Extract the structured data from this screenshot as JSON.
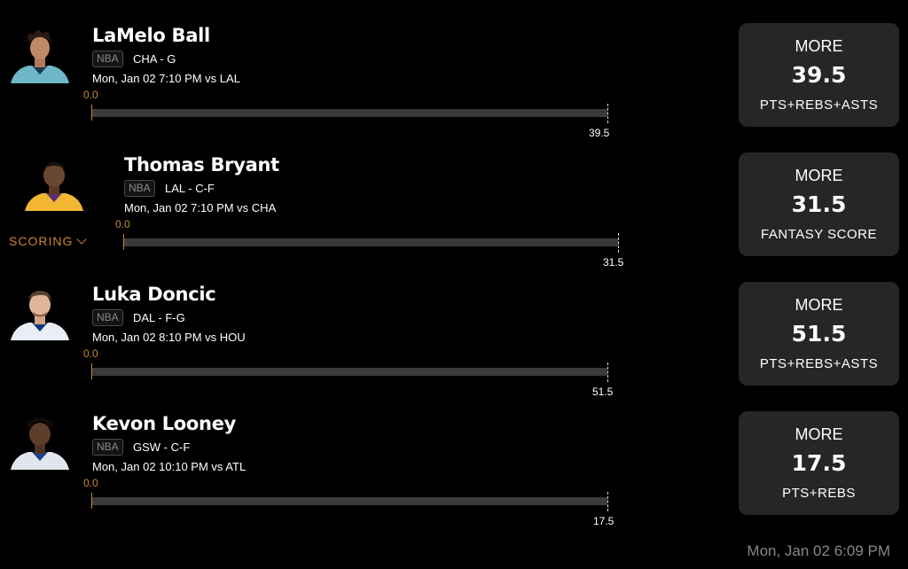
{
  "players": [
    {
      "name": "LaMelo Ball",
      "league": "NBA",
      "team_pos": "CHA - G",
      "game": "Mon, Jan 02 7:10 PM  vs LAL",
      "zero": "0.0",
      "line": "39.5",
      "pick": {
        "direction": "MORE",
        "value": "39.5",
        "stat": "PTS+REBS+ASTS"
      },
      "jersey_color": "#6fb6c9"
    },
    {
      "name": "Thomas Bryant",
      "league": "NBA",
      "team_pos": "LAL - C-F",
      "game": "Mon, Jan 02 7:10 PM  vs CHA",
      "zero": "0.0",
      "line": "31.5",
      "pick": {
        "direction": "MORE",
        "value": "31.5",
        "stat": "FANTASY SCORE"
      },
      "jersey_color": "#f2b632"
    },
    {
      "name": "Luka Doncic",
      "league": "NBA",
      "team_pos": "DAL - F-G",
      "game": "Mon, Jan 02 8:10 PM  vs HOU",
      "zero": "0.0",
      "line": "51.5",
      "pick": {
        "direction": "MORE",
        "value": "51.5",
        "stat": "PTS+REBS+ASTS"
      },
      "jersey_color": "#e8eef4"
    },
    {
      "name": "Kevon Looney",
      "league": "NBA",
      "team_pos": "GSW - C-F",
      "game": "Mon, Jan 02 10:10 PM  vs ATL",
      "zero": "0.0",
      "line": "17.5",
      "pick": {
        "direction": "MORE",
        "value": "17.5",
        "stat": "PTS+REBS"
      },
      "jersey_color": "#dfe6ee"
    }
  ],
  "scoring_label": "SCORING",
  "footer_time": "Mon, Jan 02 6:09 PM",
  "colors": {
    "accent": "#c8882a",
    "card": "#262626",
    "track": "#3a3a3a"
  }
}
